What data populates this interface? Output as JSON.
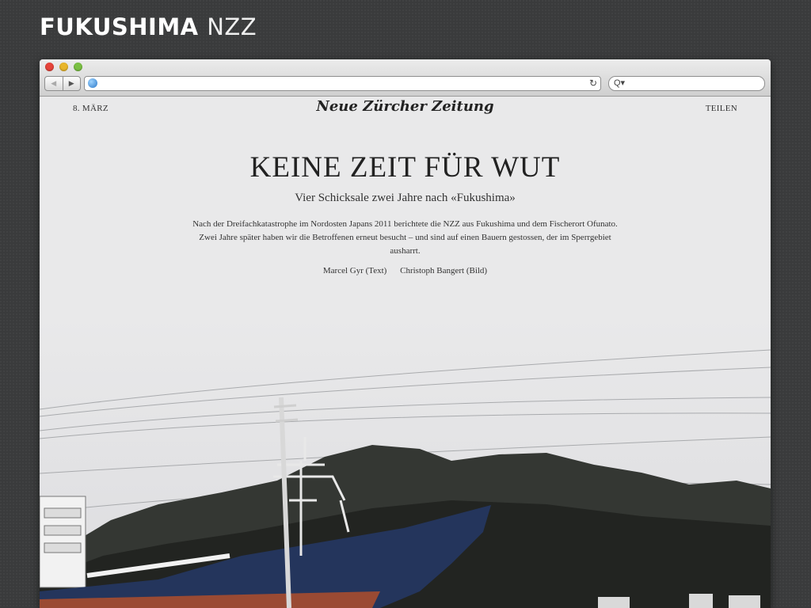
{
  "slide": {
    "title_bold": "FUKUSHIMA",
    "title_light": "NZZ"
  },
  "browser": {
    "back_icon": "◀",
    "forward_icon": "▶",
    "reload_icon": "↻",
    "search_icon": "Q▾",
    "url": "",
    "search_value": ""
  },
  "page": {
    "date": "8. MÄRZ",
    "masthead": "Neue Zürcher Zeitung",
    "share": "TEILEN",
    "headline": "KEINE ZEIT FÜR WUT",
    "subtitle": "Vier Schicksale zwei Jahre nach «Fukushima»",
    "intro": "Nach der Dreifachkatastrophe im Nordosten Japans 2011 berichtete die NZZ aus Fukushima und dem Fischerort Ofunato. Zwei Jahre später haben wir die Betroffenen erneut besucht – und sind auf einen Bauern gestossen, der im Sperrgebiet ausharrt.",
    "credit_text": "Marcel Gyr (Text)",
    "credit_image": "Christoph Bangert (Bild)"
  },
  "colors": {
    "background": "#3a3b3c",
    "page": "#e9e9ea",
    "sky": "#e6e6e8",
    "hill": "#2a2d2a",
    "hull": "#24355c",
    "hull_bottom": "#9a4a33"
  }
}
